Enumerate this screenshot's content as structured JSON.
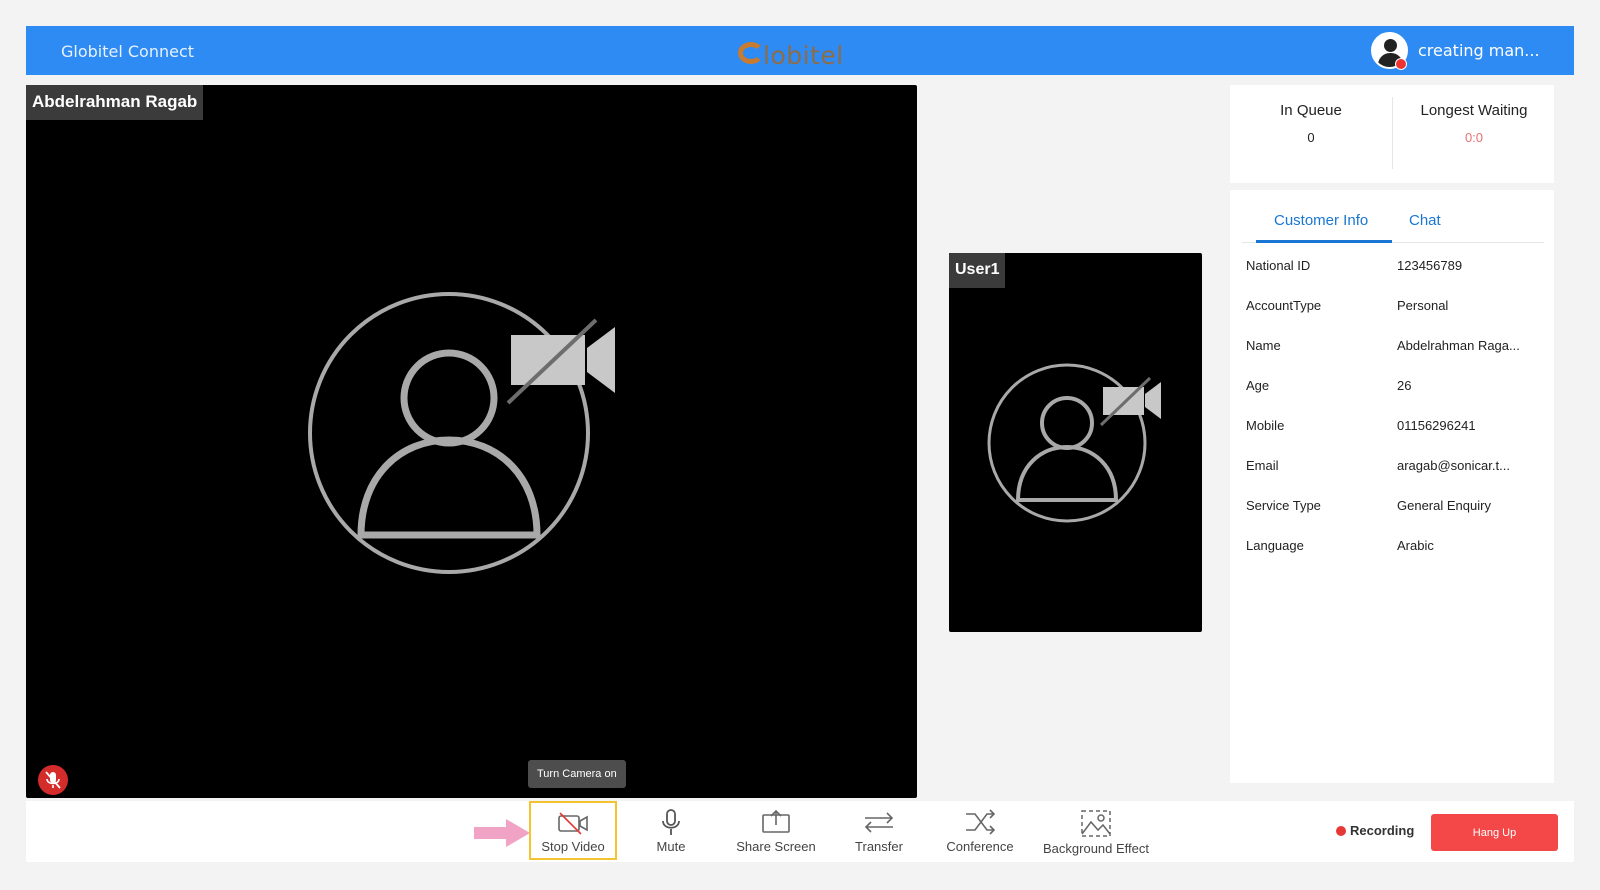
{
  "header": {
    "app_title": "Globitel Connect",
    "logo_text": "lobitel",
    "user_name": "creating man..."
  },
  "main_video": {
    "participant_name": "Abdelrahman Ragab",
    "tooltip": "Turn Camera on"
  },
  "side_video": {
    "participant_name": "User1"
  },
  "queue": {
    "in_queue_label": "In Queue",
    "in_queue_value": "0",
    "longest_waiting_label": "Longest Waiting",
    "longest_waiting_value": "0:0"
  },
  "tabs": {
    "customer_info": "Customer Info",
    "chat": "Chat",
    "active": "Customer Info"
  },
  "customer_info": [
    {
      "key": "National ID",
      "value": "123456789"
    },
    {
      "key": "AccountType",
      "value": "Personal"
    },
    {
      "key": "Name",
      "value": "Abdelrahman Raga..."
    },
    {
      "key": "Age",
      "value": "26"
    },
    {
      "key": "Mobile",
      "value": "01156296241"
    },
    {
      "key": "Email",
      "value": "aragab@sonicar.t..."
    },
    {
      "key": "Service Type",
      "value": "General Enquiry"
    },
    {
      "key": "Language",
      "value": "Arabic"
    }
  ],
  "toolbar": {
    "stop_video": "Stop Video",
    "mute": "Mute",
    "share_screen": "Share Screen",
    "transfer": "Transfer",
    "conference": "Conference",
    "background_effect": "Background Effect",
    "recording": "Recording",
    "hang_up": "Hang Up"
  },
  "colors": {
    "header_blue": "#2e8bf3",
    "tab_blue": "#1976d2",
    "hangup_red": "#f44848",
    "waiting_red": "#e57373",
    "highlight_yellow": "#f4c430",
    "arrow_pink": "#f0a3c4"
  }
}
